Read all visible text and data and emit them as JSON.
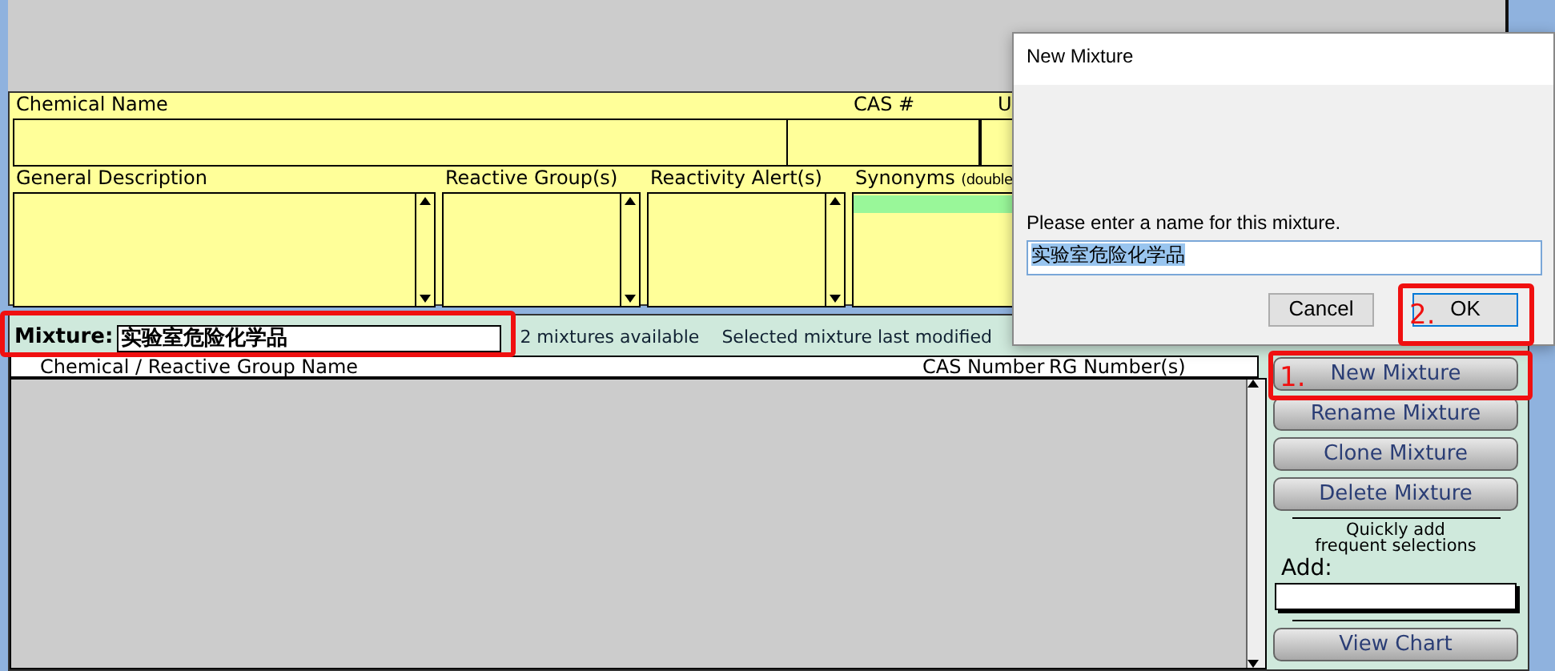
{
  "chemical_panel": {
    "labels": [
      {
        "kind": "name",
        "text": "Chemical Name"
      },
      {
        "kind": "cas",
        "text": "CAS #"
      },
      {
        "kind": "other",
        "text": "U"
      }
    ],
    "lists": [
      {
        "label": "General Description"
      },
      {
        "label": "Reactive Group(s)"
      },
      {
        "label": "Reactivity Alert(s)"
      },
      {
        "label": "Synonyms",
        "note": "(double"
      }
    ],
    "synonym_rows": [
      {
        "selected": true
      }
    ]
  },
  "mixture_panel": {
    "label": "Mixture:",
    "value": "实验室危险化学品",
    "count": "2 mixtures available",
    "modified": "Selected mixture last modified",
    "columns": [
      "Chemical / Reactive Group Name",
      "CAS Number",
      "RG Number(s)"
    ],
    "buttons": [
      "New Mixture",
      "Rename Mixture",
      "Clone Mixture",
      "Delete  Mixture"
    ],
    "quick_add": "Quickly add\nfrequent selections",
    "add_label": "Add:",
    "chart_button": "View Chart"
  },
  "dialog": {
    "title": "New Mixture",
    "prompt": "Please enter a name for this mixture.",
    "value": "实验室危险化学品",
    "buttons": [
      {
        "label": "Cancel",
        "default": false
      },
      {
        "label": "OK",
        "default": true
      }
    ]
  },
  "annotations": [
    {
      "kind": "highlight_box"
    },
    {
      "kind": "highlight_box",
      "label": "2."
    },
    {
      "kind": "highlight_box",
      "label": "1."
    }
  ]
}
